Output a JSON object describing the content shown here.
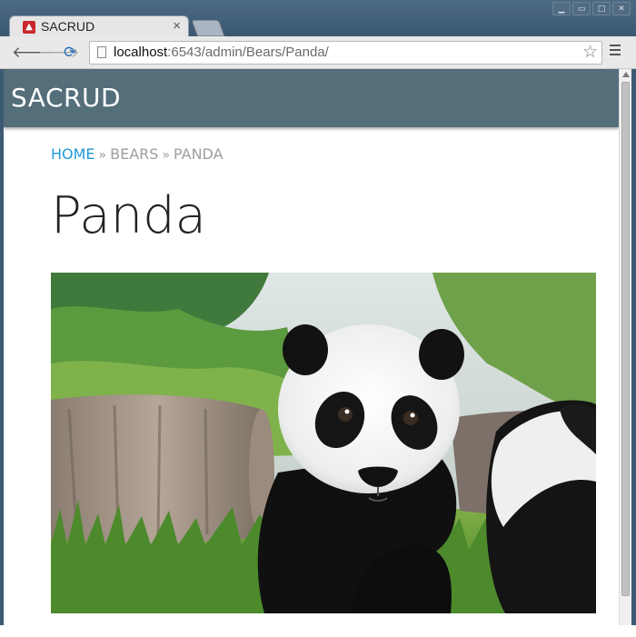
{
  "browser": {
    "tab_title": "SACRUD",
    "tab_close": "×",
    "url_host": "localhost",
    "url_rest": ":6543/admin/Bears/Panda/",
    "icons": {
      "favicon": "sacrud-favicon",
      "back": "back-arrow-icon",
      "forward": "forward-arrow-icon",
      "reload": "reload-icon",
      "page": "page-icon",
      "star": "star-icon",
      "menu": "hamburger-menu-icon"
    }
  },
  "app": {
    "brand": "SACRUD",
    "header_color": "#546e7a"
  },
  "breadcrumb": {
    "items": [
      {
        "label": "HOME",
        "link": true
      },
      {
        "label": "BEARS",
        "link": false
      },
      {
        "label": "PANDA",
        "link": false
      }
    ],
    "separator": "»",
    "link_color": "#1e9ad6"
  },
  "page": {
    "title": "Panda"
  }
}
